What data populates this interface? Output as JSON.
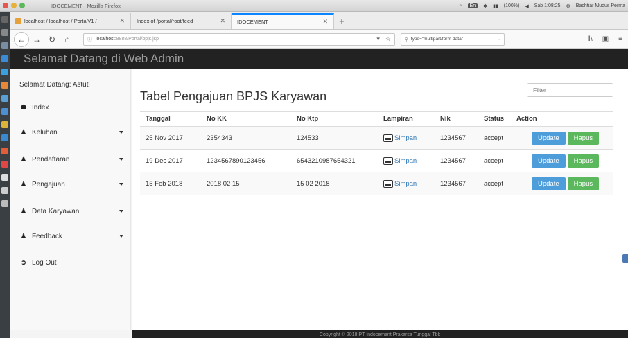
{
  "os": {
    "window_title": "IDOCEMENT - Mozilla Firefox",
    "lang": "En",
    "battery": "(100%)",
    "clock": "Sab 1:08:25",
    "user": "Bachtiar Mudus Perma"
  },
  "tabs": [
    {
      "label": "localhost / localhost / PortalV1 / ",
      "active": false
    },
    {
      "label": "Index of /portal/root/feed",
      "active": false
    },
    {
      "label": "IDOCEMENT",
      "active": true
    }
  ],
  "nav": {
    "url_host": "localhost",
    "url_path": ":8888/Portal/bpjs.jsp",
    "search_text": "type=\"multipart/form-data\""
  },
  "header": {
    "brand": "Selamat Datang di Web Admin"
  },
  "sidebar": {
    "welcome": "Selamat Datang: Astuti",
    "items": [
      {
        "label": "Index",
        "icon": "home-icon",
        "dropdown": false
      },
      {
        "label": "Keluhan",
        "icon": "users-icon",
        "dropdown": true
      },
      {
        "label": "Pendaftaran",
        "icon": "users-icon",
        "dropdown": true
      },
      {
        "label": "Pengajuan",
        "icon": "users-icon",
        "dropdown": true
      },
      {
        "label": "Data Karyawan",
        "icon": "users-icon",
        "dropdown": true
      },
      {
        "label": "Feedback",
        "icon": "users-icon",
        "dropdown": true
      },
      {
        "label": "Log Out",
        "icon": "sign-out-icon",
        "dropdown": false
      }
    ]
  },
  "main": {
    "title": "Tabel Pengajuan BPJS Karyawan",
    "filter_placeholder": "Filter",
    "columns": [
      "Tanggal",
      "No KK",
      "No Ktp",
      "Lampiran",
      "Nik",
      "Status",
      "Action"
    ],
    "rows": [
      {
        "tanggal": "25 Nov 2017",
        "no_kk": "2354343",
        "no_ktp": "124533",
        "lampiran": "Simpan",
        "nik": "1234567",
        "status": "accept"
      },
      {
        "tanggal": "19 Dec 2017",
        "no_kk": "1234567890123456",
        "no_ktp": "6543210987654321",
        "lampiran": "Simpan",
        "nik": "1234567",
        "status": "accept"
      },
      {
        "tanggal": "15 Feb 2018",
        "no_kk": "2018 02 15",
        "no_ktp": "15 02 2018",
        "lampiran": "Simpan",
        "nik": "1234567",
        "status": "accept"
      }
    ],
    "update_label": "Update",
    "hapus_label": "Hapus"
  },
  "footer": {
    "text": "Copyright © 2018 PT Indocement Prakarsa Tunggal Tbk"
  },
  "colors": {
    "header_bg": "#222222",
    "link": "#337ab7",
    "update_btn": "#4e9ddb",
    "hapus_btn": "#5cb85c"
  }
}
